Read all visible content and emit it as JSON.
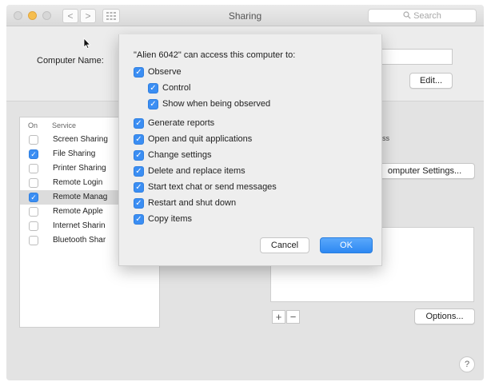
{
  "window": {
    "title": "Sharing",
    "search_placeholder": "Search",
    "nav_back": "<",
    "nav_forward": ">",
    "grid_icon": "grid-icon"
  },
  "top": {
    "computer_name_label": "Computer Name:",
    "edit_button": "Edit..."
  },
  "services": {
    "col_on": "On",
    "col_service": "Service",
    "items": [
      {
        "name": "Screen Sharing",
        "checked": false
      },
      {
        "name": "File Sharing",
        "checked": true
      },
      {
        "name": "Printer Sharing",
        "checked": false
      },
      {
        "name": "Remote Login",
        "checked": false
      },
      {
        "name": "Remote Manag",
        "checked": true
      },
      {
        "name": "Remote Apple",
        "checked": false
      },
      {
        "name": "Internet Sharin",
        "checked": false
      },
      {
        "name": "Bluetooth Shar",
        "checked": false
      }
    ],
    "selected_index": 4
  },
  "right": {
    "address_fragment": "ress",
    "computer_settings_button": "omputer Settings...",
    "plus": "+",
    "minus": "−",
    "options_button": "Options...",
    "help": "?"
  },
  "sheet": {
    "title": "\"Alien 6042\" can access this computer to:",
    "options": [
      {
        "label": "Observe",
        "checked": true,
        "indent": 0
      },
      {
        "label": "Control",
        "checked": true,
        "indent": 1
      },
      {
        "label": "Show when being observed",
        "checked": true,
        "indent": 1
      },
      {
        "label": "Generate reports",
        "checked": true,
        "indent": 0
      },
      {
        "label": "Open and quit applications",
        "checked": true,
        "indent": 0
      },
      {
        "label": "Change settings",
        "checked": true,
        "indent": 0
      },
      {
        "label": "Delete and replace items",
        "checked": true,
        "indent": 0
      },
      {
        "label": "Start text chat or send messages",
        "checked": true,
        "indent": 0
      },
      {
        "label": "Restart and shut down",
        "checked": true,
        "indent": 0
      },
      {
        "label": "Copy items",
        "checked": true,
        "indent": 0
      }
    ],
    "cancel_button": "Cancel",
    "ok_button": "OK"
  },
  "colors": {
    "accent": "#3b8ef3",
    "window_bg": "#ececec"
  }
}
